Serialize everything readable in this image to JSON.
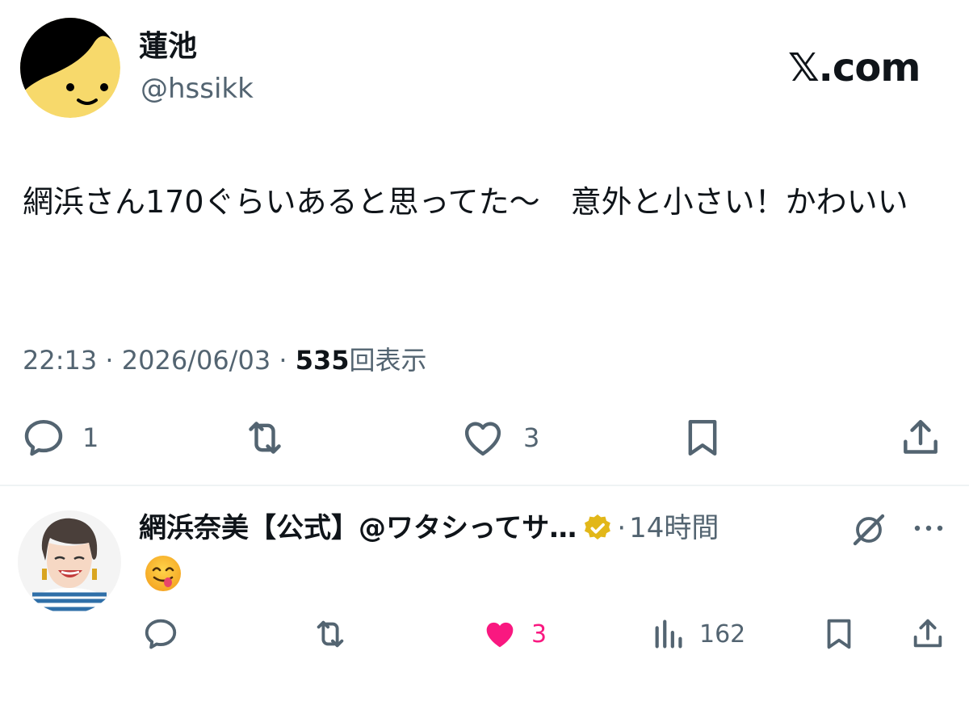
{
  "tweet": {
    "display_name": "蓮池",
    "handle": "@hssikk",
    "site_logo": "𝕏.com",
    "text": "網浜さん170ぐらいあると思ってた〜　意外と小さい！かわいい",
    "time": "22:13",
    "date": "2026/06/03",
    "separator": "·",
    "views_count": "535",
    "views_label": "回表示",
    "actions": {
      "reply_count": "1",
      "like_count": "3"
    },
    "icons": [
      "reply-icon",
      "retweet-icon",
      "like-icon",
      "bookmark-icon",
      "share-icon"
    ]
  },
  "reply": {
    "display_name": "網浜奈美【公式】@ワタシってサ…",
    "separator": "·",
    "time_ago": "14時間",
    "content_emoji": "face-savoring-food-emoji",
    "actions": {
      "like_count": "3",
      "views_count": "162"
    },
    "icons": [
      "verified-badge-icon",
      "grok-icon",
      "more-icon",
      "reply-icon",
      "retweet-icon",
      "like-icon-filled",
      "views-icon",
      "bookmark-icon",
      "share-icon"
    ]
  },
  "colors": {
    "text_primary": "#0f1419",
    "text_secondary": "#536471",
    "like_pink": "#f91880",
    "gold_badge": "#e2b719",
    "avatar_yellow": "#f7d96b"
  }
}
